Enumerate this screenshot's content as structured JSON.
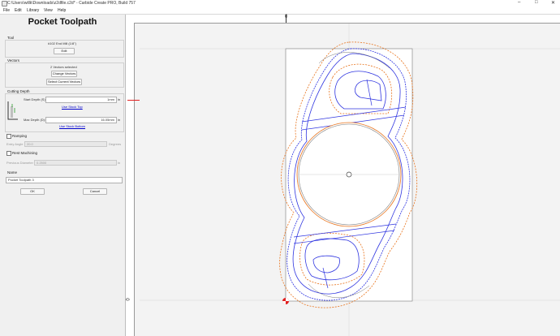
{
  "window": {
    "title": "C:\\Users\\willk\\Downloads\\z2dfile.c2d* - Carbide Create PRO, Build 757",
    "controls": [
      "–",
      "□",
      "✕"
    ]
  },
  "menu": {
    "file": "File",
    "edit": "Edit",
    "library": "Library",
    "view": "View",
    "help": "Help"
  },
  "panel": {
    "title": "Pocket Toolpath",
    "tool": {
      "label": "Tool",
      "name": "#102 End Mill (1/8\")",
      "button": "Edit"
    },
    "vectors": {
      "label": "Vectors",
      "status": "2 Vectors selected",
      "change": "Change Vectors",
      "select": "Select Current Vectors"
    },
    "cutting_depth": {
      "label": "Cutting Depth",
      "start_label": "Start Depth (S):",
      "start_value": "1mm",
      "start_unit": "in",
      "use_stock_top": "Use Stock Top",
      "max_label": "Max Depth (D):",
      "max_value": "16.05mm",
      "max_unit": "in",
      "use_stock_bottom": "Use Stock Bottom"
    },
    "ramping": {
      "label": "Ramping",
      "entry_angle_label": "Entry Angle",
      "entry_angle_value": "20.0",
      "entry_angle_unit": "Degrees"
    },
    "rest": {
      "label": "Rest Machining",
      "prev_label": "Previous Diameter",
      "prev_value": "0.2500",
      "prev_unit": "in"
    },
    "name": {
      "label": "Name",
      "value": "Pocket Toolpath 3"
    },
    "ok": "OK",
    "cancel": "Cancel"
  },
  "ruler": {
    "top_zero": "0",
    "left_zero": "0"
  },
  "colors": {
    "orange": "#e8731c",
    "blue": "#2f35e0",
    "gray": "#777777",
    "red_marker": "#e02020"
  },
  "icons": {
    "origin": "origin-marker-icon",
    "center": "center-point-icon"
  }
}
